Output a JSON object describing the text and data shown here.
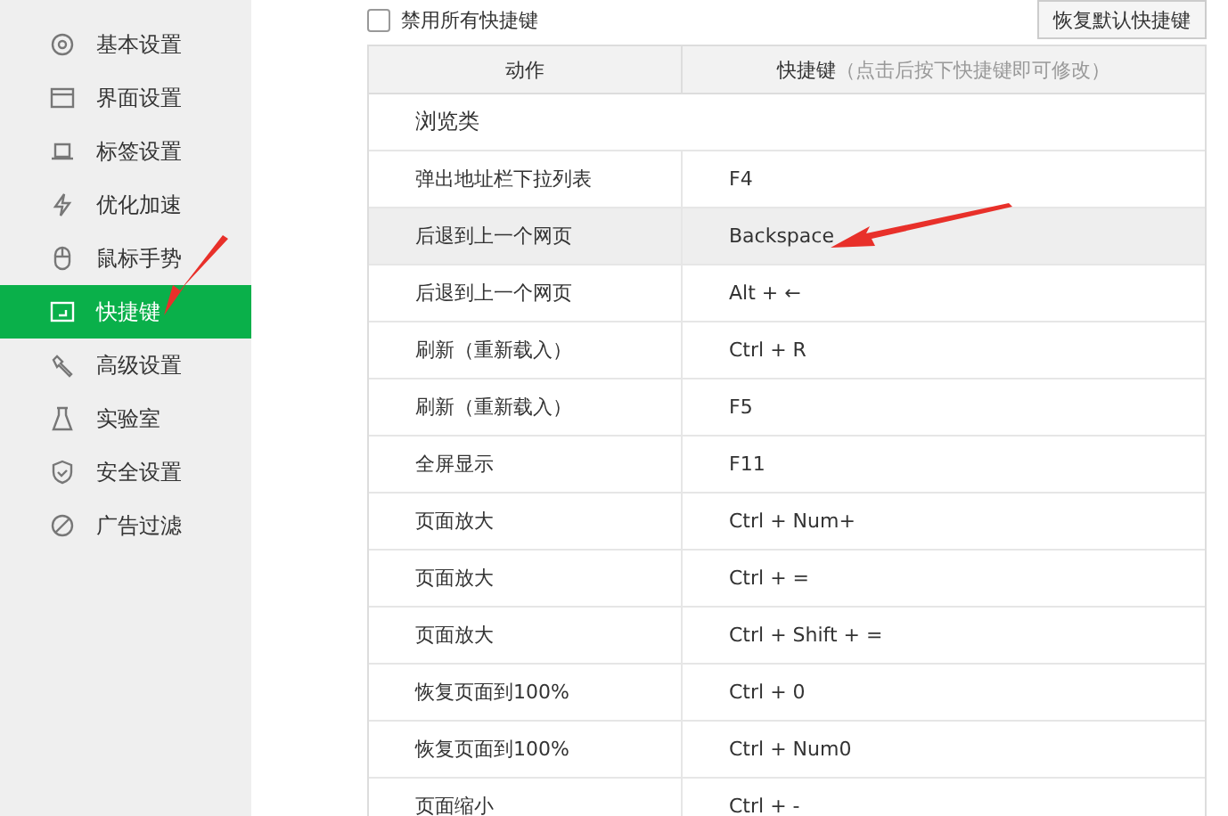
{
  "sidebar": {
    "items": [
      {
        "label": "基本设置",
        "selected": false
      },
      {
        "label": "界面设置",
        "selected": false
      },
      {
        "label": "标签设置",
        "selected": false
      },
      {
        "label": "优化加速",
        "selected": false
      },
      {
        "label": "鼠标手势",
        "selected": false
      },
      {
        "label": "快捷键",
        "selected": true
      },
      {
        "label": "高级设置",
        "selected": false
      },
      {
        "label": "实验室",
        "selected": false
      },
      {
        "label": "安全设置",
        "selected": false
      },
      {
        "label": "广告过滤",
        "selected": false
      }
    ]
  },
  "disable_all": {
    "label": "禁用所有快捷键",
    "checked": false
  },
  "restore_button": "恢复默认快捷键",
  "table": {
    "columns": [
      "动作",
      "快捷键"
    ],
    "column_hint": "（点击后按下快捷键即可修改）",
    "category": "浏览类",
    "rows": [
      {
        "action": "弹出地址栏下拉列表",
        "shortcut": "F4",
        "selected": false
      },
      {
        "action": "后退到上一个网页",
        "shortcut": "Backspace",
        "selected": true
      },
      {
        "action": "后退到上一个网页",
        "shortcut": "Alt + ←",
        "selected": false
      },
      {
        "action": "刷新（重新载入）",
        "shortcut": "Ctrl + R",
        "selected": false
      },
      {
        "action": "刷新（重新载入）",
        "shortcut": "F5",
        "selected": false
      },
      {
        "action": "全屏显示",
        "shortcut": "F11",
        "selected": false
      },
      {
        "action": "页面放大",
        "shortcut": "Ctrl + Num+",
        "selected": false
      },
      {
        "action": "页面放大",
        "shortcut": "Ctrl + =",
        "selected": false
      },
      {
        "action": "页面放大",
        "shortcut": "Ctrl + Shift + =",
        "selected": false
      },
      {
        "action": "恢复页面到100%",
        "shortcut": "Ctrl + 0",
        "selected": false
      },
      {
        "action": "恢复页面到100%",
        "shortcut": "Ctrl + Num0",
        "selected": false
      },
      {
        "action": "页面缩小",
        "shortcut": "Ctrl + -",
        "selected": false
      }
    ]
  }
}
